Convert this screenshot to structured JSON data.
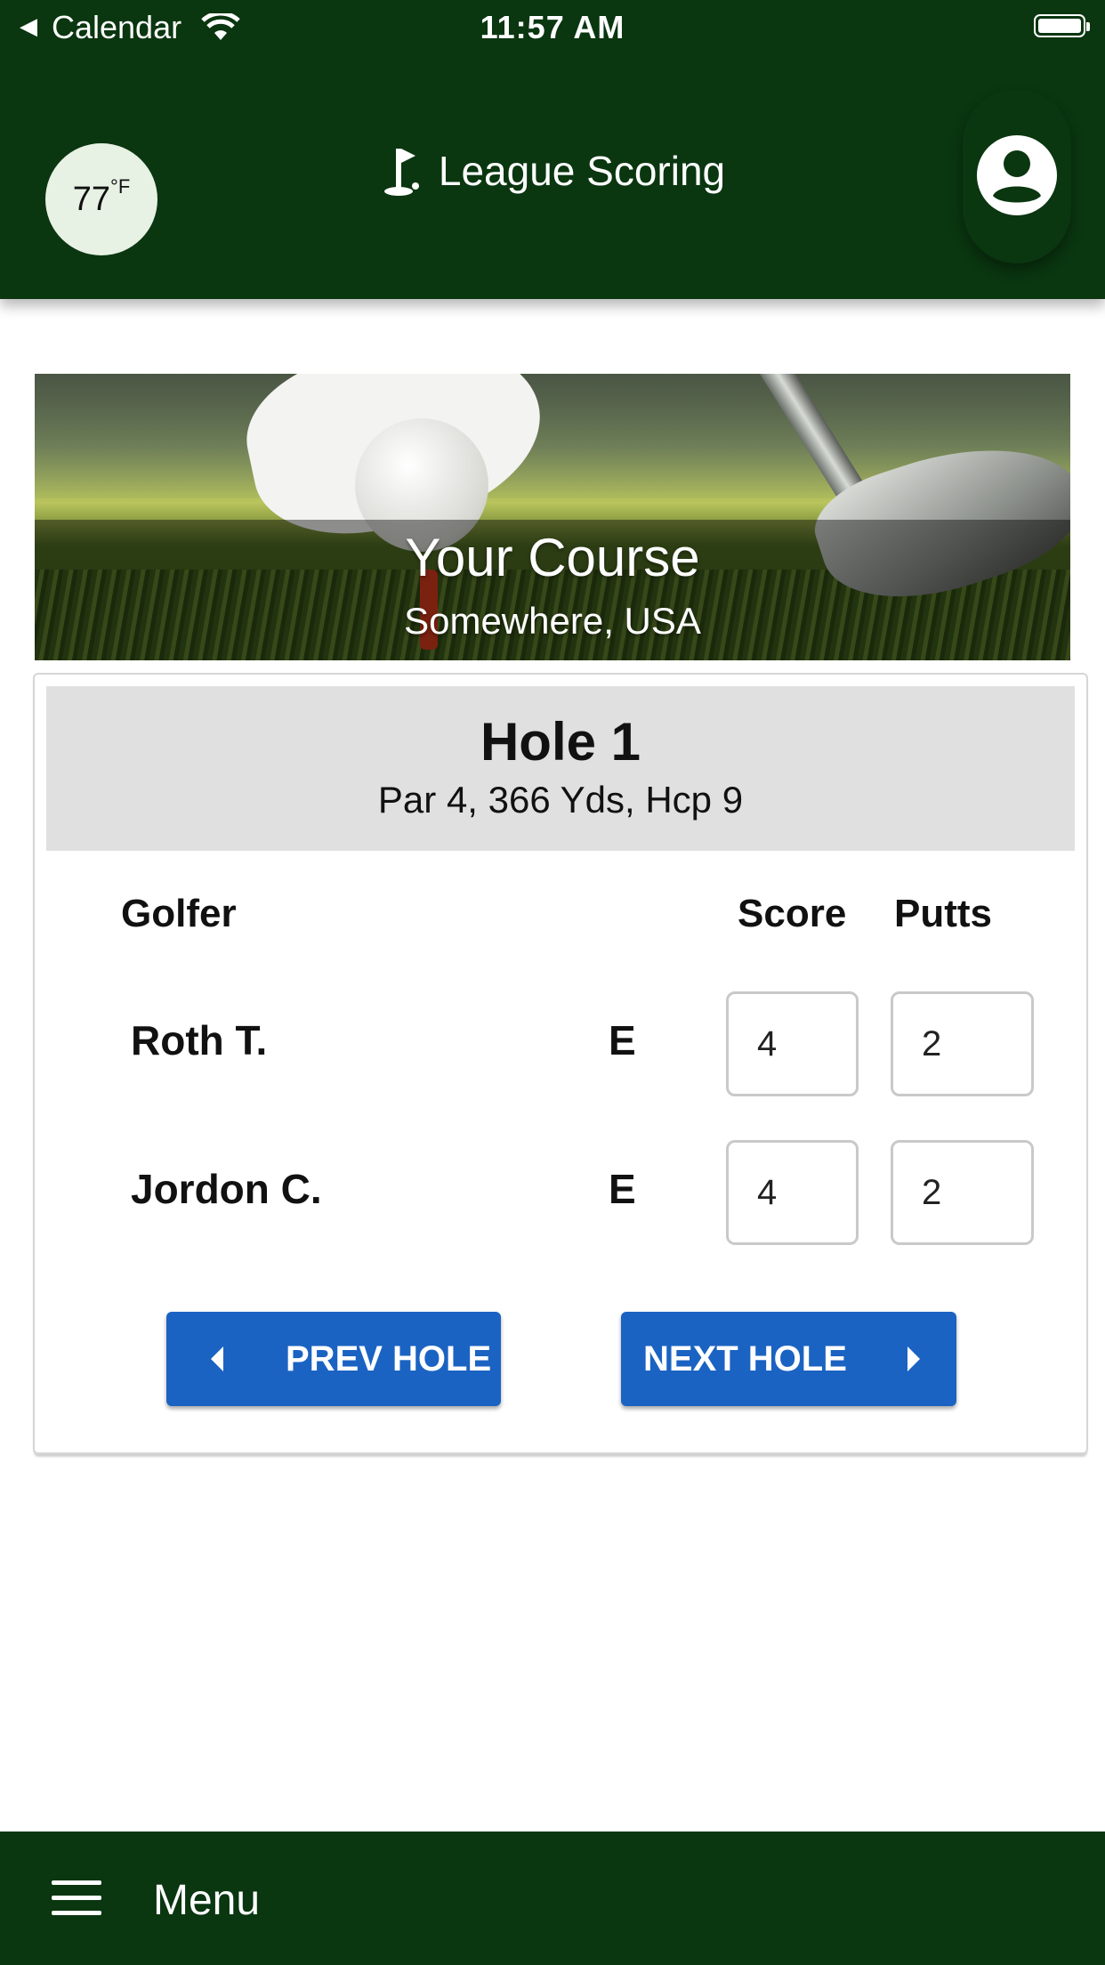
{
  "status_bar": {
    "back_app": "Calendar",
    "time": "11:57 AM"
  },
  "header": {
    "temperature": "77",
    "temperature_unit": "°F",
    "title": "League Scoring",
    "title_icon": "golf-flag-icon",
    "profile_icon": "account-circle-icon"
  },
  "course": {
    "name": "Your Course",
    "location": "Somewhere, USA"
  },
  "hole": {
    "title": "Hole 1",
    "info": "Par 4, 366 Yds, Hcp 9"
  },
  "table": {
    "columns": {
      "golfer": "Golfer",
      "score": "Score",
      "putts": "Putts"
    },
    "rows": [
      {
        "name": "Roth T.",
        "relative": "E",
        "score": "4",
        "putts": "2"
      },
      {
        "name": "Jordon C.",
        "relative": "E",
        "score": "4",
        "putts": "2"
      }
    ]
  },
  "buttons": {
    "prev": "PREV HOLE",
    "next": "NEXT HOLE"
  },
  "bottom_bar": {
    "menu_label": "Menu",
    "menu_icon": "hamburger-menu-icon"
  },
  "colors": {
    "header_green": "#0a3610",
    "button_blue": "#1a63c2",
    "hole_header_gray": "#e0e0e0"
  }
}
